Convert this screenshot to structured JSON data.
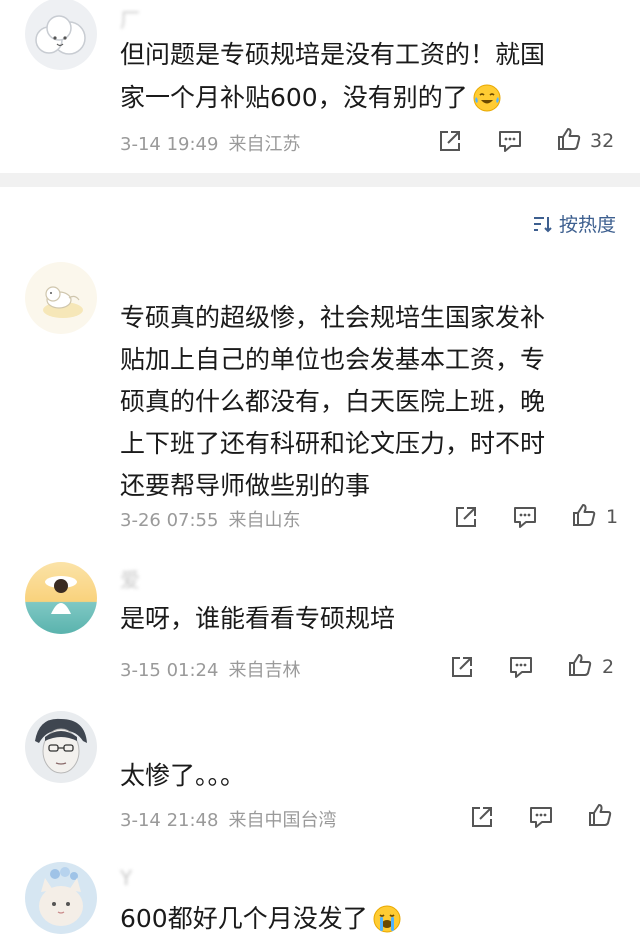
{
  "comments": [
    {
      "username": "厂",
      "text_lines": [
        "但问题是专硕规培是没有工资的！就国",
        "家一个月补贴600，没有别的了"
      ],
      "emoji": "crying-laughing-emoji",
      "time": "3-14 19:49",
      "location": "来自江苏",
      "likes": "32"
    },
    {
      "username": "",
      "text_lines": [
        "专硕真的超级惨，社会规培生国家发补",
        "贴加上自己的单位也会发基本工资，专",
        "硕真的什么都没有，白天医院上班，晚",
        "上下班了还有科研和论文压力，时不时",
        "还要帮导师做些别的事"
      ],
      "time": "3-26 07:55",
      "location": "来自山东",
      "likes": "1"
    },
    {
      "username": "爱",
      "text_lines": [
        "是呀，谁能看看专硕规培"
      ],
      "time": "3-15 01:24",
      "location": "来自吉林",
      "likes": "2"
    },
    {
      "username": "",
      "text_lines": [
        "太惨了。。。"
      ],
      "time": "3-14 21:48",
      "location": "来自中国台湾",
      "likes": ""
    },
    {
      "username": "Y",
      "text_lines": [
        "600都好几个月没发了"
      ],
      "emoji": "loudly-crying-emoji"
    }
  ],
  "sort": {
    "label": "按热度",
    "icon": "sort-icon"
  },
  "icons": {
    "repost": "share-icon",
    "comment": "comment-icon",
    "like": "thumbs-up-icon"
  },
  "colors": {
    "divider": "#f1f1f1",
    "meta_text": "#9a9a9a",
    "sort_link": "#3d5f8f"
  }
}
